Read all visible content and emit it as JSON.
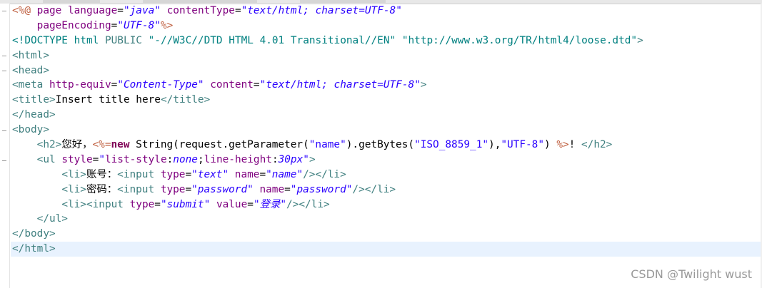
{
  "editor": {
    "lines": [
      {
        "tokens": [
          {
            "t": "<%@",
            "c": "jsp"
          },
          {
            "t": " page ",
            "c": "attr"
          },
          {
            "t": "language",
            "c": "attr"
          },
          {
            "t": "=",
            "c": "plain"
          },
          {
            "t": "\"java\"",
            "c": "val"
          },
          {
            "t": " ",
            "c": "plain"
          },
          {
            "t": "contentType",
            "c": "attr"
          },
          {
            "t": "=",
            "c": "plain"
          },
          {
            "t": "\"text/html; charset=UTF-8\"",
            "c": "val"
          }
        ]
      },
      {
        "tokens": [
          {
            "t": "    pageEncoding",
            "c": "attr"
          },
          {
            "t": "=",
            "c": "plain"
          },
          {
            "t": "\"UTF-8\"",
            "c": "val"
          },
          {
            "t": "%>",
            "c": "jsp"
          }
        ]
      },
      {
        "tokens": [
          {
            "t": "<!DOCTYPE html ",
            "c": "doctype"
          },
          {
            "t": "PUBLIC",
            "c": "tag"
          },
          {
            "t": " \"-//W3C//DTD HTML 4.01 Transitional//EN\" \"http://www.w3.org/TR/html4/loose.dtd\"",
            "c": "doctype"
          },
          {
            "t": ">",
            "c": "tag"
          }
        ]
      },
      {
        "tokens": [
          {
            "t": "<html>",
            "c": "tag"
          }
        ]
      },
      {
        "tokens": [
          {
            "t": "<head>",
            "c": "tag"
          }
        ]
      },
      {
        "tokens": [
          {
            "t": "<meta ",
            "c": "tag"
          },
          {
            "t": "http-equiv",
            "c": "attr"
          },
          {
            "t": "=",
            "c": "plain"
          },
          {
            "t": "\"Content-Type\"",
            "c": "val"
          },
          {
            "t": " ",
            "c": "plain"
          },
          {
            "t": "content",
            "c": "attr"
          },
          {
            "t": "=",
            "c": "plain"
          },
          {
            "t": "\"text/html; charset=UTF-8\"",
            "c": "val"
          },
          {
            "t": ">",
            "c": "tag"
          }
        ]
      },
      {
        "tokens": [
          {
            "t": "<title>",
            "c": "tag"
          },
          {
            "t": "Insert title here",
            "c": "plain"
          },
          {
            "t": "</title>",
            "c": "tag"
          }
        ]
      },
      {
        "tokens": [
          {
            "t": "</head>",
            "c": "tag"
          }
        ]
      },
      {
        "tokens": [
          {
            "t": "<body>",
            "c": "tag"
          }
        ]
      },
      {
        "tokens": [
          {
            "t": "    ",
            "c": "plain"
          },
          {
            "t": "<h2>",
            "c": "tag"
          },
          {
            "t": "您好，",
            "c": "plain"
          },
          {
            "t": "<%=",
            "c": "jsp"
          },
          {
            "t": "new",
            "c": "kw"
          },
          {
            "t": " String(request.getParameter(",
            "c": "plain"
          },
          {
            "t": "\"name\"",
            "c": "str"
          },
          {
            "t": ").getBytes(",
            "c": "plain"
          },
          {
            "t": "\"ISO_8859_1\"",
            "c": "str"
          },
          {
            "t": "),",
            "c": "plain"
          },
          {
            "t": "\"UTF-8\"",
            "c": "str"
          },
          {
            "t": ") ",
            "c": "plain"
          },
          {
            "t": "%>",
            "c": "jsp"
          },
          {
            "t": "! ",
            "c": "plain"
          },
          {
            "t": "</h2>",
            "c": "tag"
          }
        ]
      },
      {
        "tokens": [
          {
            "t": "    ",
            "c": "plain"
          },
          {
            "t": "<ul ",
            "c": "tag"
          },
          {
            "t": "style",
            "c": "attr"
          },
          {
            "t": "=",
            "c": "plain"
          },
          {
            "t": "\"",
            "c": "str"
          },
          {
            "t": "list-style",
            "c": "attr"
          },
          {
            "t": ":",
            "c": "plain"
          },
          {
            "t": "none",
            "c": "val"
          },
          {
            "t": ";",
            "c": "plain"
          },
          {
            "t": "line-height",
            "c": "attr"
          },
          {
            "t": ":",
            "c": "plain"
          },
          {
            "t": "30px",
            "c": "val"
          },
          {
            "t": "\"",
            "c": "str"
          },
          {
            "t": ">",
            "c": "tag"
          }
        ]
      },
      {
        "tokens": [
          {
            "t": "        ",
            "c": "plain"
          },
          {
            "t": "<li>",
            "c": "tag"
          },
          {
            "t": "账号：",
            "c": "plain"
          },
          {
            "t": "<input ",
            "c": "tag"
          },
          {
            "t": "type",
            "c": "attr"
          },
          {
            "t": "=",
            "c": "plain"
          },
          {
            "t": "\"text\"",
            "c": "val"
          },
          {
            "t": " ",
            "c": "plain"
          },
          {
            "t": "name",
            "c": "attr"
          },
          {
            "t": "=",
            "c": "plain"
          },
          {
            "t": "\"name\"",
            "c": "val"
          },
          {
            "t": "/>",
            "c": "tag"
          },
          {
            "t": "</li>",
            "c": "tag"
          }
        ]
      },
      {
        "tokens": [
          {
            "t": "        ",
            "c": "plain"
          },
          {
            "t": "<li>",
            "c": "tag"
          },
          {
            "t": "密码：",
            "c": "plain"
          },
          {
            "t": "<input ",
            "c": "tag"
          },
          {
            "t": "type",
            "c": "attr"
          },
          {
            "t": "=",
            "c": "plain"
          },
          {
            "t": "\"password\"",
            "c": "val"
          },
          {
            "t": " ",
            "c": "plain"
          },
          {
            "t": "name",
            "c": "attr"
          },
          {
            "t": "=",
            "c": "plain"
          },
          {
            "t": "\"password\"",
            "c": "val"
          },
          {
            "t": "/>",
            "c": "tag"
          },
          {
            "t": "</li>",
            "c": "tag"
          }
        ]
      },
      {
        "tokens": [
          {
            "t": "        ",
            "c": "plain"
          },
          {
            "t": "<li>",
            "c": "tag"
          },
          {
            "t": "<input ",
            "c": "tag"
          },
          {
            "t": "type",
            "c": "attr"
          },
          {
            "t": "=",
            "c": "plain"
          },
          {
            "t": "\"submit\"",
            "c": "val"
          },
          {
            "t": " ",
            "c": "plain"
          },
          {
            "t": "value",
            "c": "attr"
          },
          {
            "t": "=",
            "c": "plain"
          },
          {
            "t": "\"登录\"",
            "c": "val"
          },
          {
            "t": "/>",
            "c": "tag"
          },
          {
            "t": "</li>",
            "c": "tag"
          }
        ]
      },
      {
        "tokens": [
          {
            "t": "    ",
            "c": "plain"
          },
          {
            "t": "</ul>",
            "c": "tag"
          }
        ]
      },
      {
        "tokens": [
          {
            "t": "</body>",
            "c": "tag"
          }
        ]
      },
      {
        "tokens": [
          {
            "t": "</html>",
            "c": "tag"
          }
        ],
        "current": true
      }
    ]
  },
  "watermark": {
    "text": "CSDN @Twilight wust"
  }
}
